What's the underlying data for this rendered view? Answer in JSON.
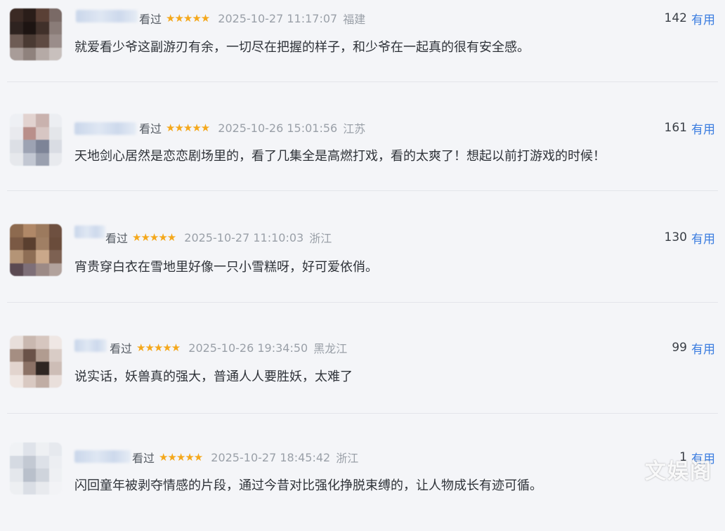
{
  "reviews": [
    {
      "watched_label": "看过",
      "stars": "★★★★★",
      "timestamp": "2025-10-27 11:17:07",
      "location": "福建",
      "helpful_count": "142",
      "helpful_label": "有用",
      "content": "就爱看少爷这副游刃有余，一切尽在把握的样子，和少爷在一起真的很有安全感。",
      "avatar_colors": [
        "#3b2a24",
        "#2a1d19",
        "#5a4036",
        "#7a6a66",
        "#2e2320",
        "#1d1412",
        "#40302a",
        "#8a7c78",
        "#6e5c55",
        "#4a3a33",
        "#5e4a42",
        "#9a8d8a",
        "#a89c98",
        "#8f827d",
        "#b5aaa6",
        "#c8c0bd"
      ]
    },
    {
      "watched_label": "看过",
      "stars": "★★★★★",
      "timestamp": "2025-10-26 15:01:56",
      "location": "江苏",
      "helpful_count": "161",
      "helpful_label": "有用",
      "content": "天地剑心居然是恋恋剧场里的，看了几集全是高燃打戏，看的太爽了！想起以前打游戏的时候！",
      "avatar_colors": [
        "#eef0f4",
        "#e2d3d0",
        "#c9b2ae",
        "#eceef2",
        "#e9eaee",
        "#b98f8a",
        "#d7c6c3",
        "#e4e6ea",
        "#dcdfe5",
        "#9da3b3",
        "#7d8497",
        "#d9dce3",
        "#e6e8ec",
        "#c2c7d2",
        "#9aa0af",
        "#e8eaee"
      ]
    },
    {
      "watched_label": "看过",
      "stars": "★★★★★",
      "timestamp": "2025-10-27 11:10:03",
      "location": "浙江",
      "helpful_count": "130",
      "helpful_label": "有用",
      "content": "宵贵穿白衣在雪地里好像一只小雪糕呀，好可爱依俏。",
      "avatar_colors": [
        "#8d6a4f",
        "#b08868",
        "#9c7a5e",
        "#6e5040",
        "#7a5944",
        "#5a3f2f",
        "#a07f64",
        "#6a4c3b",
        "#b49476",
        "#8e6e55",
        "#caa88a",
        "#7d6152",
        "#5b4a52",
        "#7e6f78",
        "#9c8a86",
        "#b2a29c"
      ]
    },
    {
      "watched_label": "看过",
      "stars": "★★★★★",
      "timestamp": "2025-10-26 19:34:50",
      "location": "黑龙江",
      "helpful_count": "99",
      "helpful_label": "有用",
      "content": "说实话，妖兽真的强大，普通人人要胜妖，太难了",
      "avatar_colors": [
        "#e8dfdb",
        "#c9b8b0",
        "#d6c6bf",
        "#efe7e4",
        "#a58e82",
        "#6a5248",
        "#b19c90",
        "#d9ccc6",
        "#e2d4ce",
        "#8c7266",
        "#2f2622",
        "#cdbdb6",
        "#efe6e2",
        "#d9c9c2",
        "#c0ada4",
        "#e9dfdb"
      ]
    },
    {
      "watched_label": "看过",
      "stars": "★★★★★",
      "timestamp": "2025-10-27 18:45:42",
      "location": "浙江",
      "helpful_count": "1",
      "helpful_label": "有用",
      "content": "闪回童年被剥夺情感的片段，通过今昔对比强化挣脱束缚的，让人物成长有迹可循。",
      "avatar_colors": [
        "#f0f2f5",
        "#dfe3ea",
        "#eef0f3",
        "#e6e9ee",
        "#d5dae2",
        "#c3c9d3",
        "#dde1e8",
        "#eceef2",
        "#e4e7ec",
        "#b9c0cb",
        "#cfd4dc",
        "#eef0f3",
        "#edeff2",
        "#dadee5",
        "#e8eaee",
        "#f2f3f6"
      ]
    }
  ],
  "watermark": "文娱阁"
}
